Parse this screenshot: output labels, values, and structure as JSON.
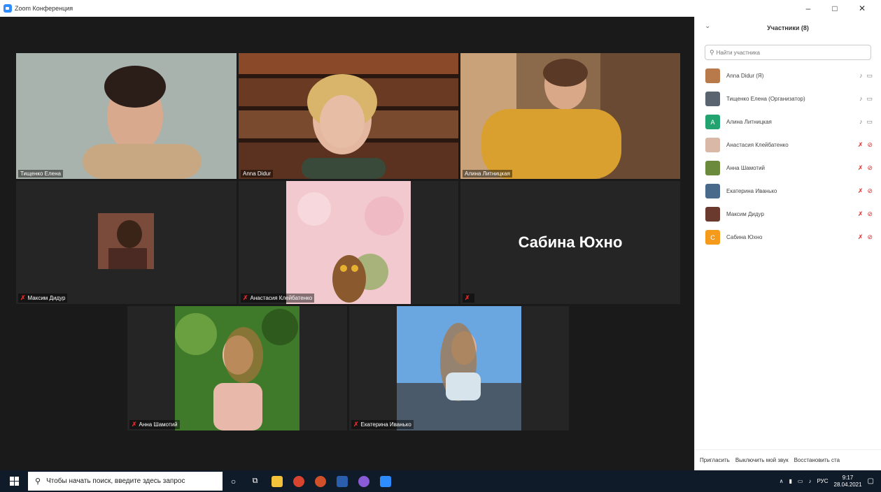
{
  "window": {
    "title": "Zoom Конференция",
    "minimize": "–",
    "maximize": "□",
    "close": "✕"
  },
  "tiles": [
    {
      "name": "Тищенко Елена",
      "muted": false,
      "active": true
    },
    {
      "name": "Anna Didur",
      "muted": false,
      "active": false
    },
    {
      "name": "Алина Литницкая",
      "muted": false,
      "active": false
    },
    {
      "name": "Максим Дидур",
      "muted": true,
      "active": false
    },
    {
      "name": "Анастасия Клейбатенко",
      "muted": true,
      "active": false
    },
    {
      "name": "",
      "big_name": "Сабина Юхно",
      "muted": true,
      "active": false
    },
    {
      "name": "Анна Шамотий",
      "muted": true,
      "active": false
    },
    {
      "name": "Екатерина Иванько",
      "muted": true,
      "active": false
    }
  ],
  "panel": {
    "title": "Участники (8)",
    "collapse_icon": "⌄",
    "search_placeholder": "Найти участника",
    "participants": [
      {
        "name": "Anna Didur (Я)",
        "avatar_text": "",
        "avatar_color": "#b87a4a",
        "mic_muted": false,
        "video_off": false
      },
      {
        "name": "Тищенко Елена (Организатор)",
        "avatar_text": "",
        "avatar_color": "#5a6470",
        "mic_muted": false,
        "video_off": false
      },
      {
        "name": "Алина Литницкая",
        "avatar_text": "A",
        "avatar_color": "#23a36f",
        "mic_muted": false,
        "video_off": false
      },
      {
        "name": "Анастасия Клейбатенко",
        "avatar_text": "",
        "avatar_color": "#d9b8a8",
        "mic_muted": true,
        "video_off": true
      },
      {
        "name": "Анна Шамотий",
        "avatar_text": "",
        "avatar_color": "#6c8a3c",
        "mic_muted": true,
        "video_off": true
      },
      {
        "name": "Екатерина Иванько",
        "avatar_text": "",
        "avatar_color": "#4a6a8c",
        "mic_muted": true,
        "video_off": true
      },
      {
        "name": "Максим Дидур",
        "avatar_text": "",
        "avatar_color": "#6b3a2e",
        "mic_muted": true,
        "video_off": true
      },
      {
        "name": "Сабина Юхно",
        "avatar_text": "С",
        "avatar_color": "#f59a1b",
        "mic_muted": true,
        "video_off": true
      }
    ],
    "footer": {
      "invite": "Пригласить",
      "mute_me": "Выключить мой звук",
      "restore": "Восстановить ста"
    }
  },
  "taskbar": {
    "search_text": "Чтобы начать поиск, введите здесь запрос",
    "lang": "РУС",
    "time": "9:17",
    "date": "28.04.2021"
  }
}
